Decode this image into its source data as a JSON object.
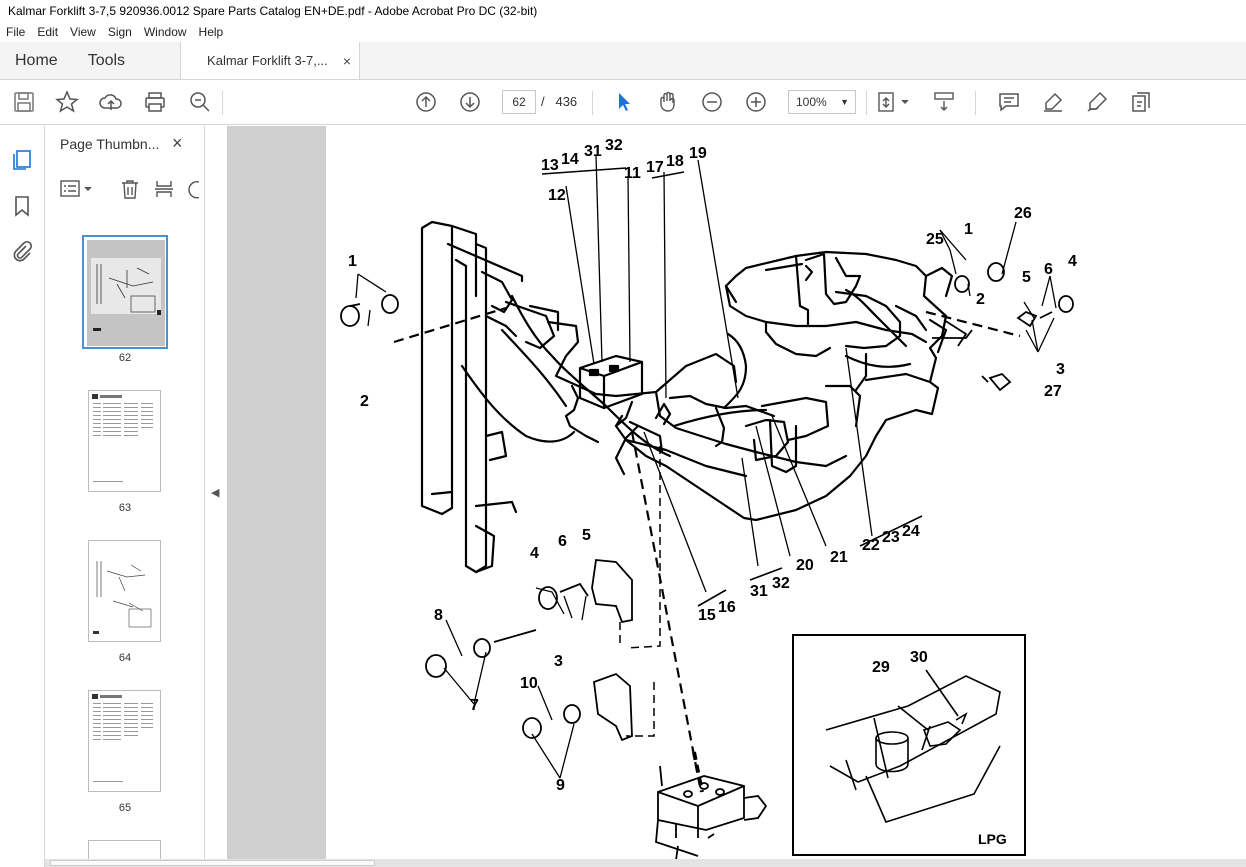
{
  "window": {
    "title": "Kalmar Forklift 3-7,5 920936.0012 Spare Parts Catalog EN+DE.pdf - Adobe Acrobat Pro DC (32-bit)"
  },
  "menu": [
    "File",
    "Edit",
    "View",
    "Sign",
    "Window",
    "Help"
  ],
  "tabs": {
    "home": "Home",
    "tools": "Tools",
    "document": "Kalmar Forklift 3-7,...",
    "close": "×"
  },
  "toolbar": {
    "current_page": "62",
    "page_separator": "/",
    "total_pages": "436",
    "zoom": "100%",
    "icons": [
      "save-icon",
      "star-icon",
      "upload-icon",
      "print-icon",
      "zoom-search-icon",
      "page-up-icon",
      "page-down-icon",
      "select-cursor-icon",
      "hand-icon",
      "zoom-out-icon",
      "zoom-in-icon",
      "fit-page-icon",
      "scroll-mode-icon",
      "comment-icon",
      "highlight-icon",
      "draw-icon",
      "fill-sign-icon"
    ]
  },
  "sidebar": {
    "title": "Page Thumbn...",
    "close": "×",
    "thumbnails": [
      {
        "label": "62",
        "selected": true
      },
      {
        "label": "63",
        "selected": false
      },
      {
        "label": "64",
        "selected": false
      },
      {
        "label": "65",
        "selected": false
      }
    ]
  },
  "diagram": {
    "callouts": [
      "13",
      "14",
      "31",
      "32",
      "11",
      "17",
      "18",
      "19",
      "12",
      "1",
      "2",
      "25",
      "26",
      "1",
      "2",
      "5",
      "6",
      "4",
      "3",
      "27",
      "22",
      "23",
      "24",
      "21",
      "20",
      "31",
      "32",
      "15",
      "16",
      "4",
      "6",
      "5",
      "3",
      "8",
      "7",
      "10",
      "9",
      "29",
      "30"
    ],
    "inset_label": "LPG"
  }
}
